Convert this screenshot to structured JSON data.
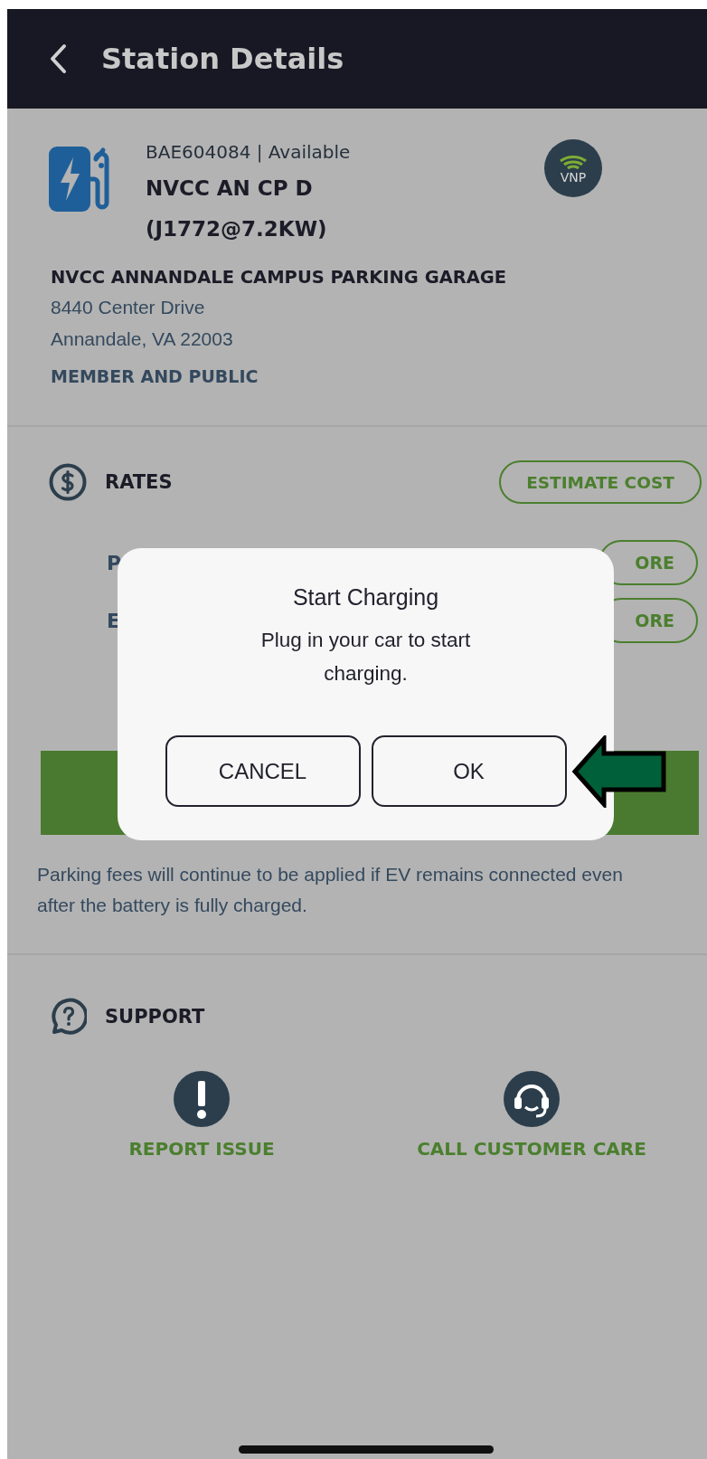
{
  "header": {
    "title": "Station Details"
  },
  "station": {
    "id_status": "BAE604084 | Available",
    "name_lines": [
      "NVCC AN CP D",
      "(J1772@7.2KW)"
    ],
    "badge": "VNP",
    "location_name": "NVCC ANNANDALE CAMPUS PARKING GARAGE",
    "address_lines": [
      "8440 Center Drive",
      "Annandale, VA 22003"
    ],
    "access": "MEMBER AND PUBLIC"
  },
  "rates": {
    "title": "RATES",
    "estimate_button": "ESTIMATE COST",
    "rows": [
      {
        "label": "P",
        "button": "ORE"
      },
      {
        "label": "E",
        "button": "ORE"
      }
    ]
  },
  "note": "Parking fees will continue to be applied if EV remains connected even after the battery is fully charged.",
  "support": {
    "title": "SUPPORT",
    "actions": [
      {
        "kind": "report",
        "label": "REPORT ISSUE"
      },
      {
        "kind": "call",
        "label": "CALL CUSTOMER CARE"
      }
    ]
  },
  "dialog": {
    "title": "Start Charging",
    "message": "Plug in your car to start charging.",
    "buttons": [
      "CANCEL",
      "OK"
    ]
  }
}
